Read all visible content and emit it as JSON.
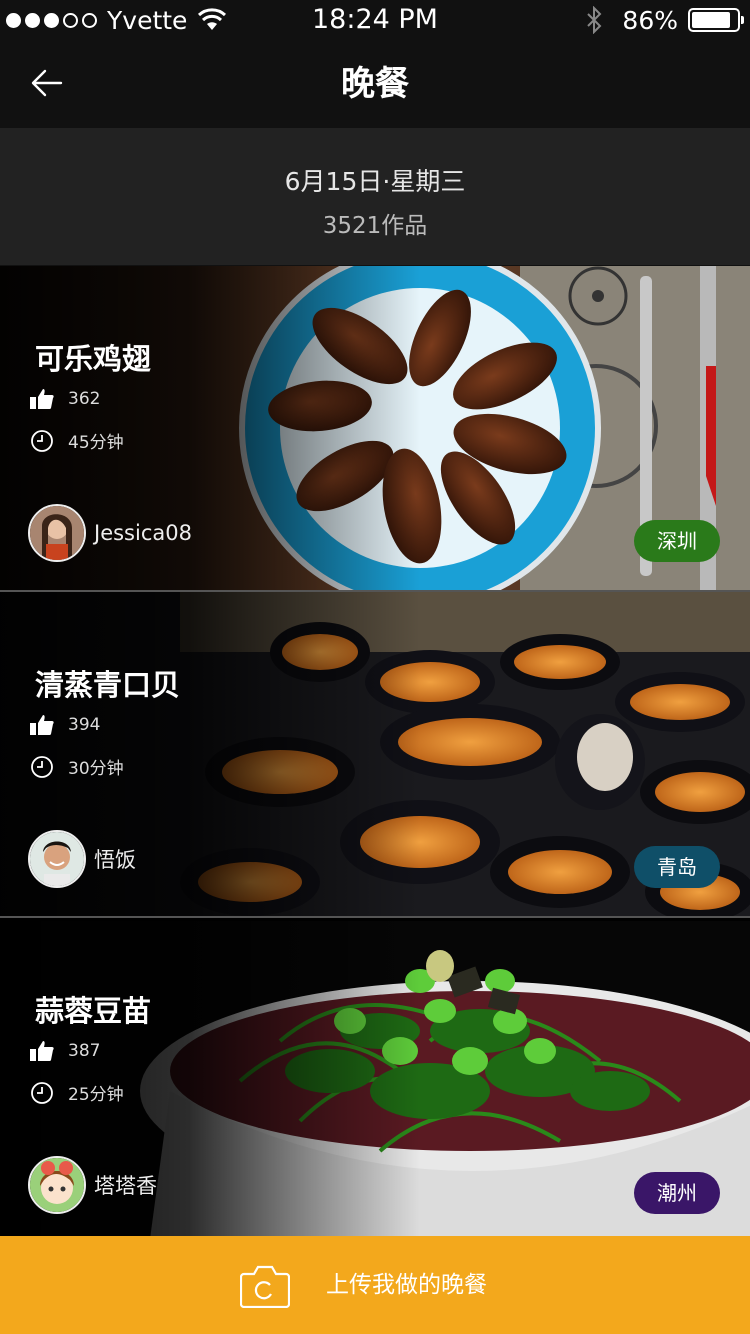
{
  "status": {
    "carrier": "Yvette",
    "time": "18:24 PM",
    "battery": "86%",
    "signal_bars": 3
  },
  "nav": {
    "title": "晚餐",
    "back_icon": "arrow-left-icon"
  },
  "header": {
    "date": "6月15日·星期三",
    "count": "3521作品"
  },
  "dishes": [
    {
      "title": "可乐鸡翅",
      "likes": "362",
      "time": "45分钟",
      "author": "Jessica08",
      "city": "深圳",
      "city_color": "#2a7a1a"
    },
    {
      "title": "清蒸青口贝",
      "likes": "394",
      "time": "30分钟",
      "author": "悟饭",
      "city": "青岛",
      "city_color": "#0f4f68"
    },
    {
      "title": "蒜蓉豆苗",
      "likes": "387",
      "time": "25分钟",
      "author": "塔塔香",
      "city": "潮州",
      "city_color": "#3a1668"
    }
  ],
  "footer": {
    "upload_label": "上传我做的晚餐",
    "icon": "camera-icon",
    "color": "#f3a81c"
  }
}
